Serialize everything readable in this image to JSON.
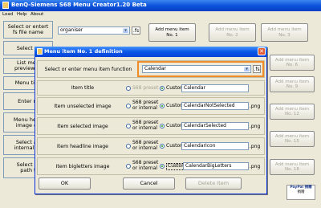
{
  "window": {
    "title": "BenQ-Siemens S68 Menu Creator1.20 Beta",
    "menu": [
      "Load",
      "Help",
      "About"
    ]
  },
  "left_panels": [
    {
      "label": "Select or entert\nfs file name"
    },
    {
      "label": "Select m"
    },
    {
      "label": "List men\npreview m"
    },
    {
      "label": "Menu title"
    },
    {
      "label": "Enter m"
    },
    {
      "label": "Menu head\nimage op"
    },
    {
      "label": "Select an\ninternal he"
    },
    {
      "label": "Select or\npath t"
    }
  ],
  "file_name_value": "organiser",
  "fs_label": ".fs",
  "menu_buttons": [
    "Add menu item\nNo. 1",
    "Add menu item\nNo. 2",
    "Add menu item\nNo. 3",
    "Add menu item\nNo. 6",
    "Add menu item\nNo. 9",
    "Add menu item\nNo. 12",
    "Add menu item\nNo. 15",
    "Add menu item\nNo. 18"
  ],
  "paypal": {
    "line1": "PayPal 捐赠",
    "line2": "捐赠"
  },
  "dialog": {
    "title": "Menu item No. 1 definition",
    "function_label": "Select or enter menu item function",
    "function_value": "Calendar",
    "fs_label": ".fs",
    "preset_label": "S68 preset",
    "preset_or_internal_label": "S68 preset\nor internal",
    "custom_label": "Custom",
    "png_label": ".png",
    "rows": [
      {
        "label": "Item title",
        "value": "Calendar"
      },
      {
        "label": "Item unselected image",
        "value": "CalendarNotSelected"
      },
      {
        "label": "Item selected image",
        "value": "CalendarSelected"
      },
      {
        "label": "Item headline image",
        "value": "CalendarIcon"
      },
      {
        "label": "Item bigletters image",
        "value": "CalendarBigLetters"
      }
    ],
    "ok_label": "OK",
    "cancel_label": "Cancel",
    "delete_label": "Delete Item"
  }
}
